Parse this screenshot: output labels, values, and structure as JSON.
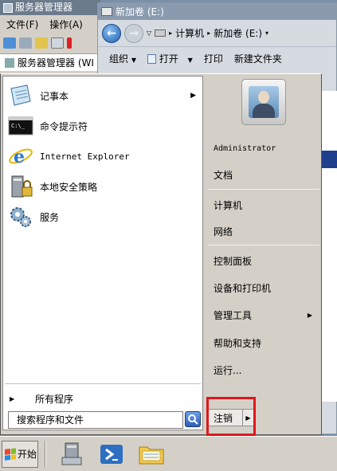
{
  "server_manager": {
    "title": "服务器管理器",
    "menu": [
      "文件(F)",
      "操作(A)"
    ],
    "tree_item": "服务器管理器 (WI"
  },
  "explorer": {
    "title": "新加卷 (E:)",
    "breadcrumb": [
      "计算机",
      "新加卷 (E:)"
    ],
    "commands": {
      "organize": "组织",
      "open": "打开",
      "print": "打印",
      "new_folder": "新建文件夹"
    }
  },
  "start_menu": {
    "programs": [
      {
        "label": "记事本",
        "icon": "notepad-icon",
        "has_submenu": true
      },
      {
        "label": "命令提示符",
        "icon": "cmd-icon",
        "has_submenu": false
      },
      {
        "label": "Internet Explorer",
        "icon": "ie-icon",
        "has_submenu": false
      },
      {
        "label": "本地安全策略",
        "icon": "security-policy-icon",
        "has_submenu": false
      },
      {
        "label": "服务",
        "icon": "services-gear-icon",
        "has_submenu": false
      }
    ],
    "all_programs": "所有程序",
    "search_placeholder": "搜索程序和文件",
    "right": {
      "user": "Administrator",
      "documents": "文档",
      "computer": "计算机",
      "network": "网络",
      "control_panel": "控制面板",
      "devices_printers": "设备和打印机",
      "admin_tools": "管理工具",
      "help": "帮助和支持",
      "run": "运行...",
      "logoff": "注销"
    }
  },
  "taskbar": {
    "start_label": "开始"
  },
  "colors": {
    "highlight_box": "#e0161b",
    "selection_blue": "#1f3e8c"
  }
}
